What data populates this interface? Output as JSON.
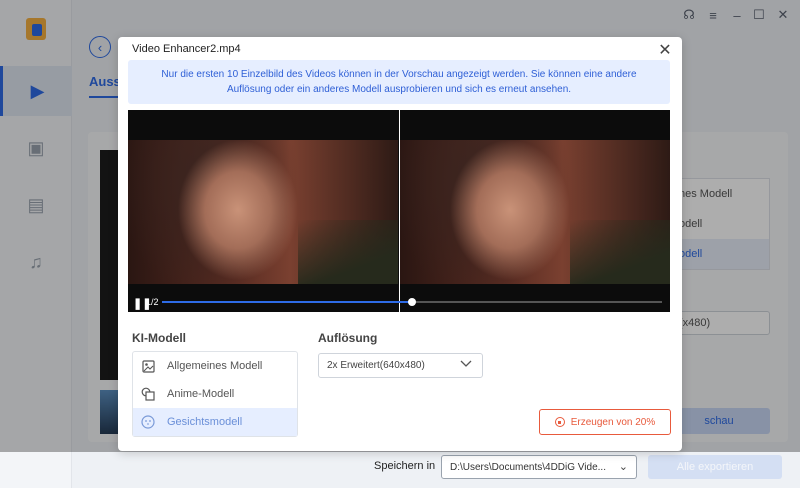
{
  "window_controls": [
    "headset-icon",
    "menu-icon",
    "minimize-icon",
    "maximize-icon",
    "close-icon"
  ],
  "background": {
    "tab_label": "Ausst",
    "model_list": [
      "nes Modell",
      "odell",
      "odell"
    ],
    "resolution_value": "(x480)",
    "preview_button": "schau",
    "save_label": "Speichern in",
    "save_path": "D:\\Users\\Documents\\4DDiG Vide...",
    "export_button": "Alle exportieren"
  },
  "dialog": {
    "title": "Video Enhancer2.mp4",
    "notice": "Nur die ersten 10 Einzelbild des Videos können in der Vorschau angezeigt werden. Sie können eine andere Auflösung oder ein anderes Modell ausprobieren und sich es erneut ansehen.",
    "playback": {
      "counter": "1/2",
      "progress": 0.5
    },
    "model_section_label": "KI-Modell",
    "models": [
      {
        "label": "Allgemeines Modell",
        "icon": "image-icon",
        "selected": false
      },
      {
        "label": "Anime-Modell",
        "icon": "shapes-icon",
        "selected": false
      },
      {
        "label": "Gesichtsmodell",
        "icon": "face-icon",
        "selected": true
      }
    ],
    "resolution_section_label": "Auflösung",
    "resolution_value": "2x Erweitert(640x480)",
    "generate_button": "Erzeugen von 20%"
  },
  "colors": {
    "accent": "#2e6be6",
    "danger": "#e85a3c",
    "notice_bg": "#e6eeff"
  }
}
